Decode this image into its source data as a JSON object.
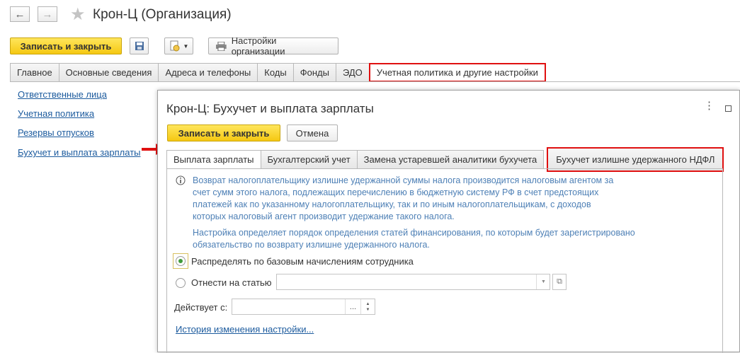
{
  "window": {
    "title": "Крон-Ц (Организация)"
  },
  "toolbar": {
    "save_close": "Записать и закрыть",
    "org_settings": "Настройки организации"
  },
  "tabs": [
    "Главное",
    "Основные сведения",
    "Адреса и телефоны",
    "Коды",
    "Фонды",
    "ЭДО",
    "Учетная политика и другие настройки"
  ],
  "sidebar": {
    "links": [
      "Ответственные лица",
      "Учетная политика",
      "Резервы отпусков",
      "Бухучет и выплата зарплаты"
    ]
  },
  "dialog": {
    "title": "Крон-Ц: Бухучет и выплата зарплаты",
    "save_close": "Записать и закрыть",
    "cancel": "Отмена",
    "tabs": [
      "Выплата зарплаты",
      "Бухгалтерский учет",
      "Замена устаревшей аналитики бухучета",
      "Бухучет излишне удержанного НДФЛ"
    ],
    "info_lines": [
      "Возврат налогоплательщику излишне удержанной суммы налога производится налоговым агентом за",
      "счет сумм этого налога, подлежащих перечислению в бюджетную систему РФ в счет предстоящих",
      "платежей как по указанному налогоплательщику, так и по иным налогоплательщикам, с доходов",
      "которых налоговый агент производит удержание такого налога."
    ],
    "info2_lines": [
      "Настройка определяет порядок определения статей финансирования, по которым будет зарегистрировано",
      "обязательство по возврату излишне удержанного налога."
    ],
    "radio1": "Распределять по базовым начислениям сотрудника",
    "radio2": "Отнести на статью",
    "valid_from_label": "Действует с:",
    "history_link": "История изменения настройки..."
  },
  "colors": {
    "accent_yellow": "#f5c812",
    "highlight_red": "#e01010",
    "link": "#1c5b9e",
    "info_text": "#4e80b6"
  }
}
